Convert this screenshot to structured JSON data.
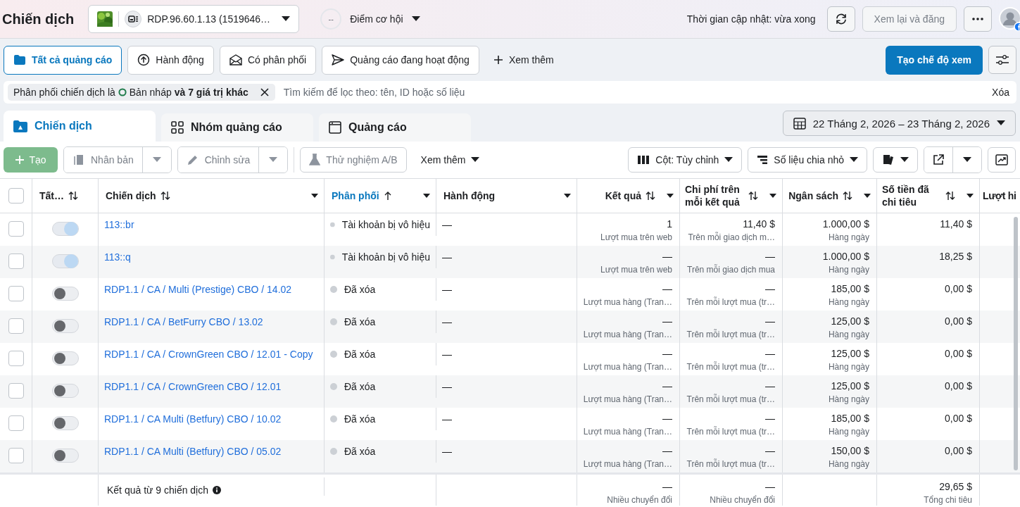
{
  "top_bar": {
    "title": "Chiến dịch",
    "account": {
      "name": "RDP.96.60.1.13 (1519646…"
    },
    "opportunity": {
      "score": "--",
      "label": "Điểm cơ hội"
    },
    "updated": "Thời gian cập nhật: vừa xong",
    "review_button": {
      "label": "Xem lại và đăng",
      "disabled": true
    }
  },
  "filter_tabs": [
    {
      "label": "Tất cả quảng cáo",
      "kind": "folder",
      "selected": true
    },
    {
      "label": "Hành động",
      "kind": "upload",
      "selected": false
    },
    {
      "label": "Có phân phối",
      "kind": "mail",
      "selected": false
    },
    {
      "label": "Quảng cáo đang hoạt động",
      "kind": "send",
      "selected": false
    }
  ],
  "more_filters": "Xem thêm",
  "create_view": "Tạo chế độ xem",
  "filter": {
    "prefix": "Phân phối chiến dịch là",
    "value": "Bản nháp",
    "suffix": "và 7 giá trị khác",
    "search_placeholder": "Tìm kiếm để lọc theo: tên, ID hoặc số liệu",
    "clear": "Xóa"
  },
  "level_tabs": [
    {
      "label": "Chiến dịch",
      "kind": "campaign",
      "selected": true
    },
    {
      "label": "Nhóm quảng cáo",
      "kind": "grid",
      "selected": false
    },
    {
      "label": "Quảng cáo",
      "kind": "window",
      "selected": false
    }
  ],
  "date_range": "22 Tháng 2, 2026 – 23 Tháng 2, 2026",
  "toolbar": {
    "create": {
      "label": "Tạo",
      "disabled": true
    },
    "duplicate": {
      "label": "Nhân bản",
      "disabled": true
    },
    "edit": {
      "label": "Chỉnh sửa",
      "disabled": true
    },
    "ab_test": {
      "label": "Thử nghiệm A/B",
      "disabled": true
    },
    "more": "Xem thêm",
    "columns": "Cột: Tùy chỉnh",
    "breakdown": "Số liệu chia nhỏ"
  },
  "table": {
    "select_all": false,
    "columns": [
      {
        "label": "Tất…",
        "kind": "sortable",
        "menu": false,
        "active": false
      },
      {
        "label": "Chiến dịch",
        "kind": "sortable",
        "menu": true,
        "active": false
      },
      {
        "label": "Phân phối",
        "kind": "ascending",
        "menu": true,
        "active": true
      },
      {
        "label": "Hành động",
        "kind": "plain",
        "menu": true,
        "active": false
      },
      {
        "label": "Kết quả",
        "kind": "sortable",
        "menu": true,
        "active": false
      },
      {
        "label": "Chi phí trên mỗi kết quả",
        "kind": "sortable",
        "menu": true,
        "active": false
      },
      {
        "label": "Ngân sách",
        "kind": "sortable",
        "menu": true,
        "active": false
      },
      {
        "label": "Số tiền đã chi tiêu",
        "kind": "sortable",
        "menu": true,
        "active": false
      },
      {
        "label": "Lượt hi",
        "kind": "plain",
        "menu": false,
        "active": false
      }
    ],
    "rows": [
      {
        "checked": false,
        "on": true,
        "name": "113::br",
        "delivery": "Tài khoản bị vô hiệu",
        "actions": "—",
        "result": "1",
        "result_type": "Lượt mua trên web",
        "cost": "11,40 $",
        "cost_type": "Trên mỗi giao dịch m…",
        "budget": "1.000,00 $",
        "budget_type": "Hàng ngày",
        "spent": "11,40 $"
      },
      {
        "checked": false,
        "on": true,
        "name": "113::q",
        "delivery": "Tài khoản bị vô hiệu",
        "actions": "—",
        "result": "—",
        "result_type": "Lượt mua trên web",
        "cost": "—",
        "cost_type": "Trên mỗi giao dịch mua",
        "budget": "1.000,00 $",
        "budget_type": "Hàng ngày",
        "spent": "18,25 $"
      },
      {
        "checked": false,
        "on": false,
        "name": "RDP1.1 / CA / Multi (Prestige) CBO / 14.02",
        "delivery": "Đã xóa",
        "actions": "—",
        "result": "—",
        "result_type": "Lượt mua hàng (Tran…",
        "cost": "—",
        "cost_type": "Trên mỗi lượt mua (tr…",
        "budget": "185,00 $",
        "budget_type": "Hàng ngày",
        "spent": "0,00 $"
      },
      {
        "checked": false,
        "on": false,
        "name": "RDP1.1 / CA / BetFurry CBO / 13.02",
        "delivery": "Đã xóa",
        "actions": "—",
        "result": "—",
        "result_type": "Lượt mua hàng (Tran…",
        "cost": "—",
        "cost_type": "Trên mỗi lượt mua (tr…",
        "budget": "125,00 $",
        "budget_type": "Hàng ngày",
        "spent": "0,00 $"
      },
      {
        "checked": false,
        "on": false,
        "name": "RDP1.1 / CA / CrownGreen CBO / 12.01 - Copy",
        "delivery": "Đã xóa",
        "actions": "—",
        "result": "—",
        "result_type": "Lượt mua hàng (Tran…",
        "cost": "—",
        "cost_type": "Trên mỗi lượt mua (tr…",
        "budget": "125,00 $",
        "budget_type": "Hàng ngày",
        "spent": "0,00 $"
      },
      {
        "checked": false,
        "on": false,
        "name": "RDP1.1 / CA / CrownGreen CBO / 12.01",
        "delivery": "Đã xóa",
        "actions": "—",
        "result": "—",
        "result_type": "Lượt mua hàng (Tran…",
        "cost": "—",
        "cost_type": "Trên mỗi lượt mua (tr…",
        "budget": "125,00 $",
        "budget_type": "Hàng ngày",
        "spent": "0,00 $"
      },
      {
        "checked": false,
        "on": false,
        "name": "RDP1.1 / CA Multi (Betfury) CBO / 10.02",
        "delivery": "Đã xóa",
        "actions": "—",
        "result": "—",
        "result_type": "Lượt mua hàng (Tran…",
        "cost": "—",
        "cost_type": "Trên mỗi lượt mua (tr…",
        "budget": "185,00 $",
        "budget_type": "Hàng ngày",
        "spent": "0,00 $"
      },
      {
        "checked": false,
        "on": false,
        "name": "RDP1.1 / CA Multi (Betfury) CBO / 05.02",
        "delivery": "Đã xóa",
        "actions": "—",
        "result": "—",
        "result_type": "Lượt mua hàng (Tran…",
        "cost": "—",
        "cost_type": "Trên mỗi lượt mua (tr…",
        "budget": "150,00 $",
        "budget_type": "Hàng ngày",
        "spent": "0,00 $"
      }
    ],
    "summary": {
      "label": "Kết quả từ 9 chiến dịch",
      "result": "—",
      "result_type": "Nhiều chuyển đổi",
      "cost": "—",
      "cost_type": "Nhiều chuyển đổi",
      "spent": "29,65 $",
      "spent_type": "Tổng chi tiêu"
    }
  }
}
